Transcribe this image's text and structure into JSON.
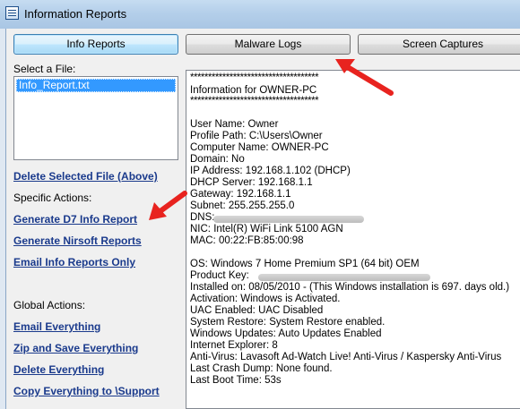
{
  "window": {
    "title": "Information Reports",
    "icon": "report-window-icon"
  },
  "toolbar": {
    "tabs": [
      {
        "label": "Info Reports",
        "active": true
      },
      {
        "label": "Malware Logs",
        "active": false
      },
      {
        "label": "Screen Captures",
        "active": false
      }
    ]
  },
  "files": {
    "label": "Select a File:",
    "items": [
      "Info_Report.txt"
    ],
    "selected": "Info_Report.txt"
  },
  "actions": {
    "delete_selected": "Delete Selected File (Above)",
    "specific_label": "Specific Actions:",
    "specific": [
      "Generate D7 Info Report",
      "Generate Nirsoft Reports",
      "Email Info Reports Only"
    ],
    "global_label": "Global Actions:",
    "global": [
      "Email Everything",
      "Zip and Save Everything",
      "Delete Everything",
      "Copy Everything to \\Support"
    ]
  },
  "report": {
    "stars": "************************************",
    "header": "Information for OWNER-PC",
    "lines": [
      "User Name:  Owner",
      "Profile Path:  C:\\Users\\Owner",
      "Computer Name:  OWNER-PC",
      "Domain:  No",
      "IP Address:  192.168.1.102 (DHCP)",
      "DHCP Server:  192.168.1.1",
      "Gateway:  192.168.1.1",
      "Subnet:  255.255.255.0",
      "DNS:",
      "NIC:  Intel(R) WiFi Link 5100 AGN",
      "MAC:  00:22:FB:85:00:98",
      "OS:  Windows 7 Home Premium SP1 (64 bit) OEM",
      "Product Key:",
      "Installed on:  08/05/2010 - (This Windows installation is 697. days old.)",
      "Activation:  Windows is Activated.",
      "UAC Enabled:  UAC Disabled",
      "System Restore:  System Restore enabled.",
      "Windows Updates:  Auto Updates Enabled",
      "Internet Explorer:  8",
      "Anti-Virus:  Lavasoft Ad-Watch Live! Anti-Virus / Kaspersky Anti-Virus",
      "Last Crash Dump:  None found.",
      "Last Boot Time:  53s"
    ]
  },
  "colors": {
    "link": "#1a3a8c",
    "selection": "#3399ff",
    "arrow": "#e8231f"
  }
}
